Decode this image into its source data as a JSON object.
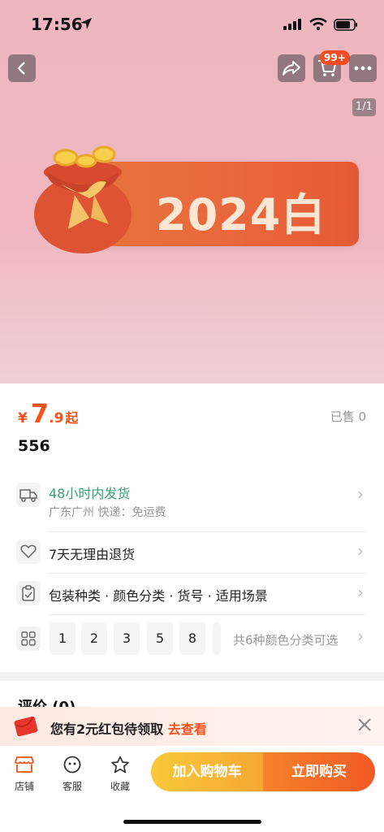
{
  "status_bar": {
    "time": "17:56"
  },
  "nav": {
    "cart_badge": "99+",
    "pager": "1/1"
  },
  "banner": {
    "text": "2024白"
  },
  "product": {
    "currency": "¥",
    "price_int": "7",
    "price_dec": ".9",
    "price_suffix": "起",
    "sold": "已售 0",
    "name": "556"
  },
  "shipping": {
    "title": "48小时内发货",
    "subtitle": "广东广州  快递：免运费"
  },
  "returns": {
    "label": "7天无理由退货"
  },
  "specs": {
    "label": "包装种类 · 颜色分类 · 货号 · 适用场景"
  },
  "options": {
    "chips": [
      "1",
      "2",
      "3",
      "5",
      "8"
    ],
    "more": "共6种颜色分类可选"
  },
  "reviews": {
    "title": "评价 (0)"
  },
  "red_packet": {
    "text": "您有2元红包待领取",
    "link": "去查看"
  },
  "bottom_bar": {
    "tabs": [
      "店铺",
      "客服",
      "收藏"
    ],
    "add_to_cart": "加入购物车",
    "buy_now": "立即购买"
  },
  "colors": {
    "accent": "#f2521c",
    "green": "#3b9c74",
    "cart_btn": "#f8b737",
    "buy_btn": "#f15a24"
  }
}
